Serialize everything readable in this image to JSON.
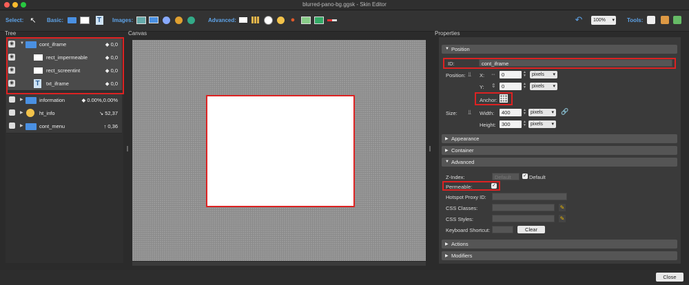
{
  "window": {
    "title": "blurred-pano-bg.ggsk - Skin Editor"
  },
  "toolbar": {
    "select_label": "Select:",
    "basic_label": "Basic:",
    "images_label": "Images:",
    "advanced_label": "Advanced:",
    "tools_label": "Tools:",
    "zoom_value": "100%"
  },
  "panels": {
    "tree_title": "Tree",
    "canvas_title": "Canvas",
    "properties_title": "Properties"
  },
  "tree": {
    "items": [
      {
        "name": "cont_iframe",
        "value": "◆ 0,0"
      },
      {
        "name": "rect_impermeable",
        "value": "◆ 0,0"
      },
      {
        "name": "rect_screentint",
        "value": "◆ 0,0"
      },
      {
        "name": "txt_iframe",
        "value": "◆ 0,0"
      },
      {
        "name": "information",
        "value": "◆ 0.00%,0.00%"
      },
      {
        "name": "ht_info",
        "value": "↘ 52,37"
      },
      {
        "name": "cont_menu",
        "value": "↑ 0,36"
      }
    ]
  },
  "properties": {
    "position_section": "Position",
    "id_label": "ID:",
    "id_value": "cont_iframe",
    "position_label": "Position:",
    "x_label": "X:",
    "x_value": "0",
    "y_label": "Y:",
    "y_value": "0",
    "pixels_unit": "pixels",
    "anchor_label": "Anchor:",
    "size_label": "Size:",
    "width_label": "Width:",
    "width_value": "400",
    "height_label": "Height:",
    "height_value": "300",
    "appearance_section": "Appearance",
    "container_section": "Container",
    "advanced_section": "Advanced",
    "zindex_label": "Z-Index:",
    "zindex_placeholder": "Default",
    "zindex_default_label": "Default",
    "permeable_label": "Permeable:",
    "hotspot_proxy_label": "Hotspot Proxy ID:",
    "css_classes_label": "CSS Classes:",
    "css_styles_label": "CSS Styles:",
    "keyboard_shortcut_label": "Keyboard Shortcut:",
    "clear_button": "Clear",
    "actions_section": "Actions",
    "modifiers_section": "Modifiers"
  },
  "footer": {
    "close_button": "Close"
  },
  "colors": {
    "accent_label": "#5ea3e8",
    "highlight": "#dd2222",
    "folder": "#4a90e2"
  }
}
